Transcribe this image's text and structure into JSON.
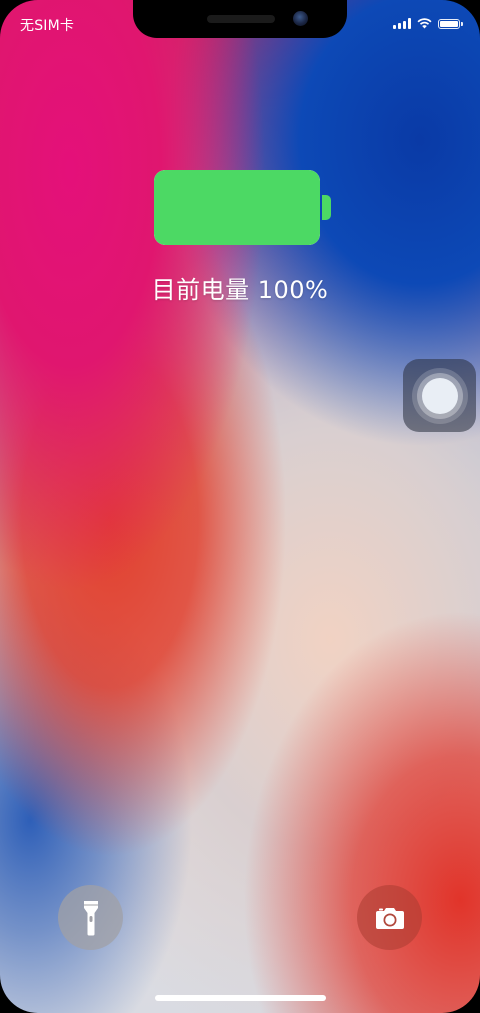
{
  "status_bar": {
    "carrier": "无SIM卡",
    "signal_icon": "cellular-signal-icon",
    "wifi_icon": "wifi-icon",
    "battery_icon": "battery-icon",
    "battery_level": 1.0
  },
  "charging": {
    "text": "目前电量 100%",
    "level": 1.0,
    "fill_color": "#4cd964"
  },
  "assistive_touch": {
    "icon": "assistive-touch-icon"
  },
  "bottom_controls": {
    "left_icon": "flashlight-icon",
    "right_icon": "camera-icon"
  },
  "colors": {
    "battery_green": "#4cd964",
    "text": "#ffffff"
  }
}
